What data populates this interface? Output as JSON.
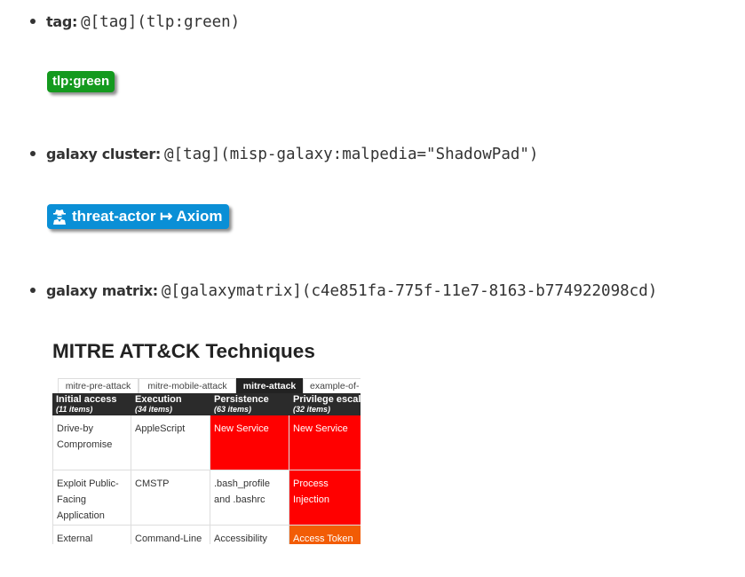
{
  "items": [
    {
      "label": "tag:",
      "code": "@[tag](tlp:green)"
    },
    {
      "label": "galaxy cluster:",
      "code": "@[tag](misp-galaxy:malpedia=\"ShadowPad\")"
    },
    {
      "label": "galaxy matrix:",
      "code": "@[galaxymatrix](c4e851fa-775f-11e7-8163-b774922098cd)"
    }
  ],
  "tag_green": {
    "text": "tlp:green",
    "color": "#149a1e"
  },
  "tag_galaxy": {
    "text": "threat-actor ↦ Axiom",
    "icon": "user-secret-icon",
    "color": "#0a8fd6"
  },
  "matrix": {
    "title": "MITRE ATT&CK Techniques",
    "tabs": [
      "mitre-pre-attack",
      "mitre-mobile-attack",
      "mitre-attack",
      "example-of-"
    ],
    "active_tab": "mitre-attack",
    "columns": [
      {
        "name": "Initial access",
        "count": "(11 items)"
      },
      {
        "name": "Execution",
        "count": "(34 items)"
      },
      {
        "name": "Persistence",
        "count": "(63 items)"
      },
      {
        "name": "Privilege escala",
        "count": "(32 items)"
      }
    ],
    "rows": [
      [
        "Drive-by Compromise",
        "AppleScript",
        "New Service",
        "New Service"
      ],
      [
        "Exploit Public-Facing Application",
        "CMSTP",
        ".bash_profile and .bashrc",
        "Process Injection"
      ],
      [
        "External",
        "Command-Line",
        "Accessibility",
        "Access Token"
      ]
    ],
    "colors": {
      "red": "#ff0000",
      "orange": "#f25c05",
      "header": "#2b2b2b"
    }
  }
}
